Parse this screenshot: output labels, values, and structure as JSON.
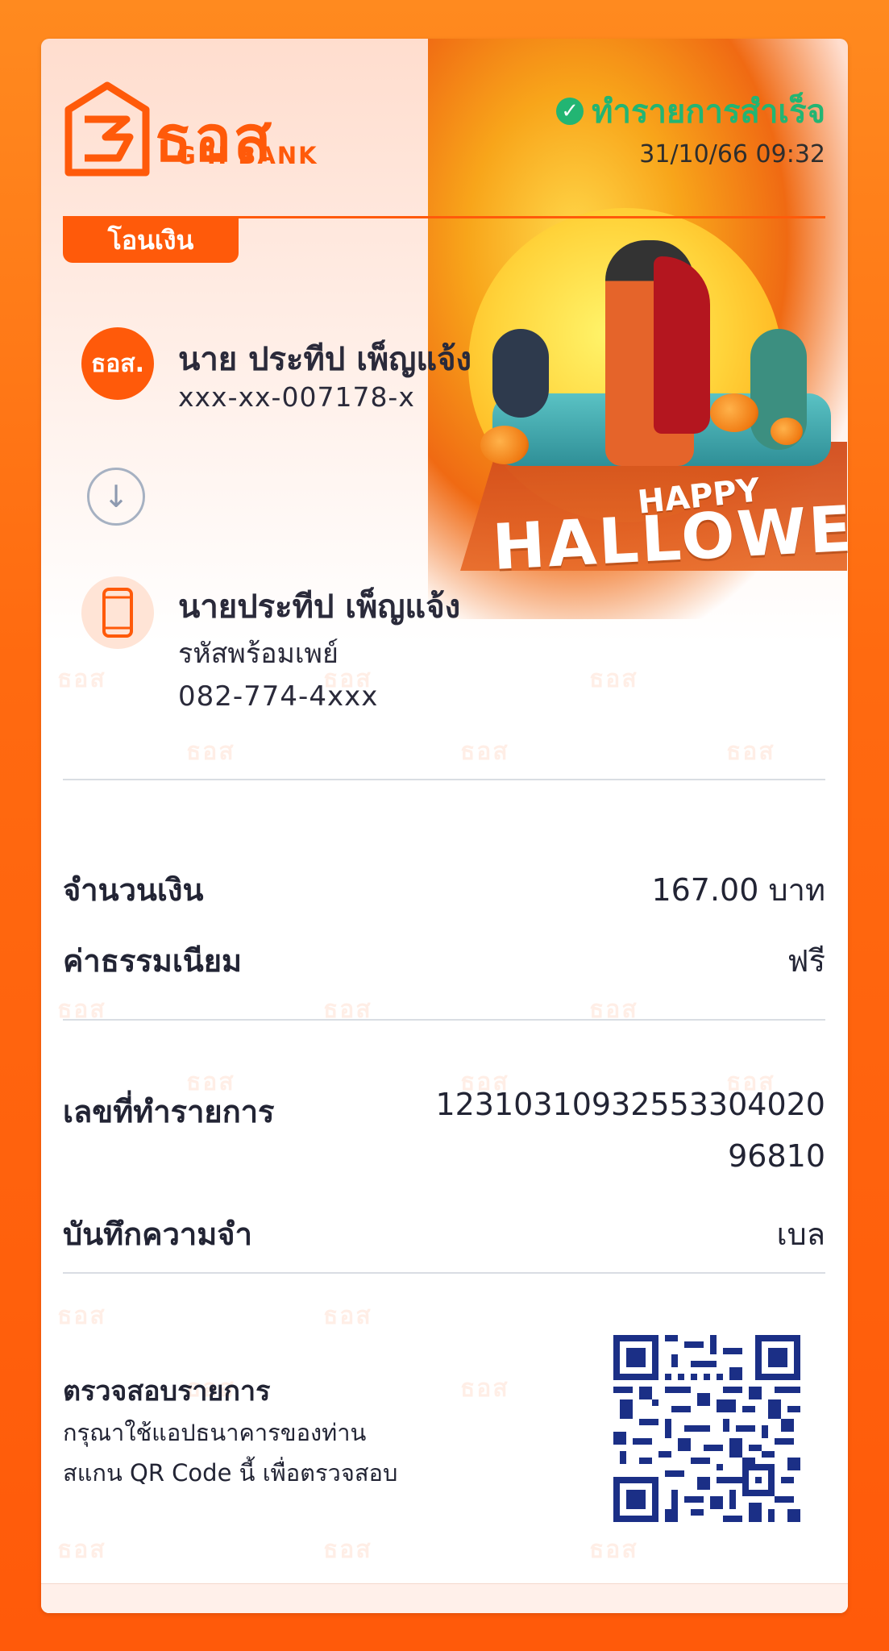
{
  "bank": {
    "logo_thai": "ธอส",
    "logo_eng": "G H BANK",
    "avatar_text": "ธอส."
  },
  "status": {
    "text": "ทำรายการสำเร็จ",
    "datetime": "31/10/66 09:32",
    "color": "#22b573"
  },
  "transaction_type": "โอนเงิน",
  "banner": {
    "happy": "HAPPY",
    "halloween": "HALLOWEEN"
  },
  "sender": {
    "name": "นาย ประทีป เพ็ญแจ้ง",
    "account": "xxx-xx-007178-x"
  },
  "receiver": {
    "name": "นายประทีป เพ็ญแจ้ง",
    "type": "รหัสพร้อมเพย์",
    "phone": "082-774-4xxx"
  },
  "amount": {
    "label": "จำนวนเงิน",
    "value": "167.00 บาท"
  },
  "fee": {
    "label": "ค่าธรรมเนียม",
    "value": "ฟรี"
  },
  "reference": {
    "label": "เลขที่ทำรายการ",
    "value_line1": "12310310932553304020",
    "value_line2": "96810"
  },
  "memo": {
    "label": "บันทึกความจำ",
    "value": "เบล"
  },
  "verify": {
    "title": "ตรวจสอบรายการ",
    "line1": "กรุณาใช้แอปธนาคารของท่าน",
    "line2": "สแกน QR Code นี้ เพื่อตรวจสอบ"
  },
  "colors": {
    "brand_orange": "#ff5a0a",
    "text_dark": "#222434",
    "qr_blue": "#1b2f86"
  }
}
